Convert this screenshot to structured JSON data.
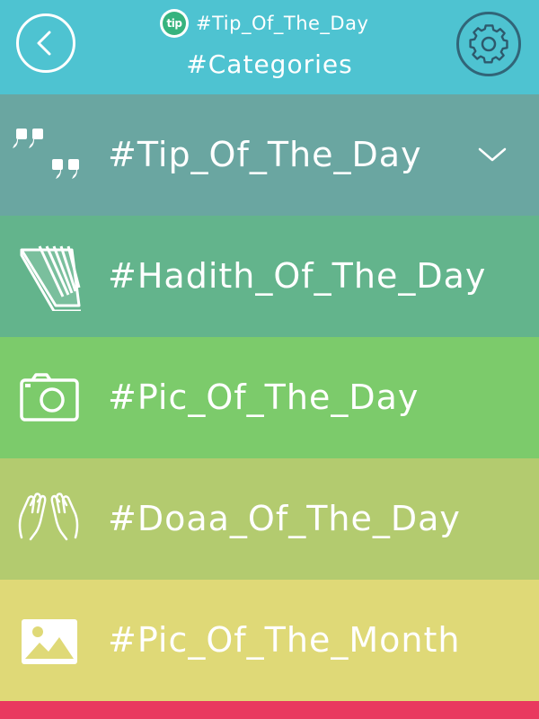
{
  "header": {
    "brand_logo_text": "tip",
    "brand_text": "#Tip_Of_The_Day",
    "title": "#Categories",
    "back_icon": "back-arrow-icon",
    "settings_icon": "gear-icon",
    "background": "#4ec3d1"
  },
  "categories": {
    "items": [
      {
        "label": "#Tip_Of_The_Day",
        "icon": "quote-icon",
        "color": "#6aa6a1",
        "expandable": true
      },
      {
        "label": "#Hadith_Of_The_Day",
        "icon": "book-icon",
        "color": "#63b48c"
      },
      {
        "label": "#Pic_Of_The_Day",
        "icon": "camera-icon",
        "color": "#7ccb6b"
      },
      {
        "label": "#Doaa_Of_The_Day",
        "icon": "praying-hands-icon",
        "color": "#b3cb6f"
      },
      {
        "label": "#Pic_Of_The_Month",
        "icon": "image-icon",
        "color": "#dfd977"
      }
    ]
  },
  "footer_color": "#e9395f"
}
